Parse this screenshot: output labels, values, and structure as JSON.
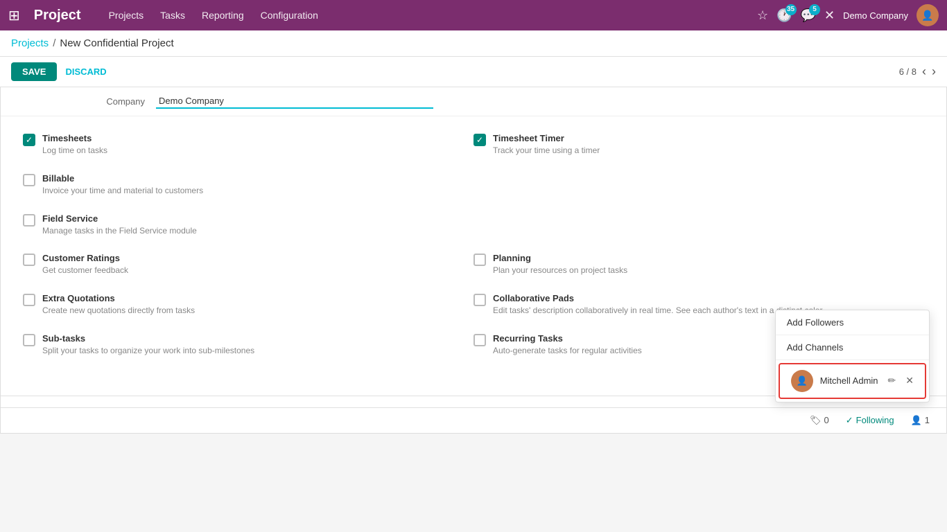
{
  "navbar": {
    "title": "Project",
    "menu": [
      "Projects",
      "Tasks",
      "Reporting",
      "Configuration"
    ],
    "badge_clock": "35",
    "badge_chat": "5",
    "company": "Demo Company"
  },
  "breadcrumb": {
    "parent": "Projects",
    "separator": "/",
    "current": "New Confidential Project"
  },
  "toolbar": {
    "save_label": "SAVE",
    "discard_label": "DISCARD",
    "pagination": "6 / 8"
  },
  "company_field": {
    "label": "Company",
    "value": "Demo Company"
  },
  "settings": [
    {
      "id": "timesheets",
      "checked": true,
      "title": "Timesheets",
      "desc": "Log time on tasks"
    },
    {
      "id": "billable",
      "checked": false,
      "title": "Billable",
      "desc": "Invoice your time and material to customers"
    },
    {
      "id": "field_service",
      "checked": false,
      "title": "Field Service",
      "desc": "Manage tasks in the Field Service module"
    },
    {
      "id": "customer_ratings",
      "checked": false,
      "title": "Customer Ratings",
      "desc": "Get customer feedback"
    },
    {
      "id": "extra_quotations",
      "checked": false,
      "title": "Extra Quotations",
      "desc": "Create new quotations directly from tasks"
    },
    {
      "id": "sub_tasks",
      "checked": false,
      "title": "Sub-tasks",
      "desc": "Split your tasks to organize your work into sub-milestones"
    }
  ],
  "settings_right": [
    {
      "id": "timesheet_timer",
      "checked": true,
      "title": "Timesheet Timer",
      "desc": "Track your time using a timer"
    },
    {
      "id": "planning",
      "checked": false,
      "title": "Planning",
      "desc": "Plan your resources on project tasks"
    },
    {
      "id": "collaborative_pads",
      "checked": false,
      "title": "Collaborative Pads",
      "desc": "Edit tasks' description collaboratively in real time. See each author's text in a distinct color."
    },
    {
      "id": "recurring_tasks",
      "checked": false,
      "title": "Recurring Tasks",
      "desc": "Auto-generate tasks for regular activities"
    }
  ],
  "bottom_bar": {
    "tags_count": "0",
    "following_label": "Following",
    "followers_count": "1"
  },
  "dropdown": {
    "items": [
      "Add Followers",
      "Add Channels"
    ]
  },
  "user": {
    "name": "Mitchell Admin"
  }
}
